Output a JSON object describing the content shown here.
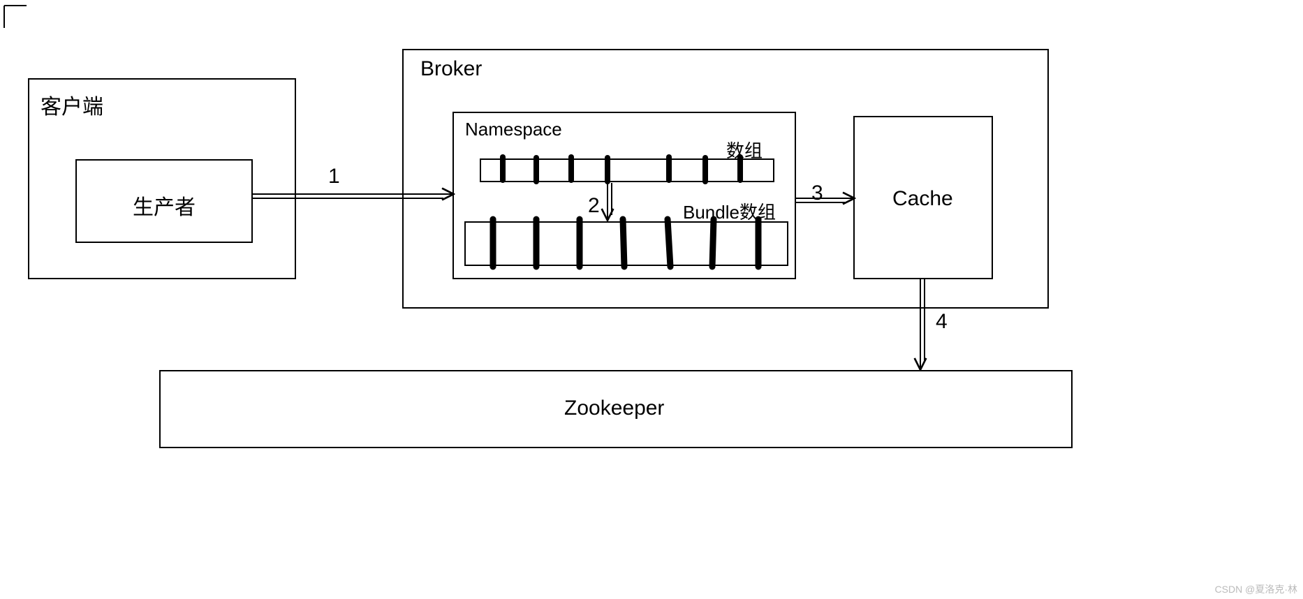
{
  "client": {
    "title": "客户端",
    "producer": "生产者"
  },
  "broker": {
    "title": "Broker",
    "namespace": {
      "title": "Namespace",
      "array_label": "数组",
      "bundle_label": "Bundle数组"
    },
    "cache": "Cache"
  },
  "zookeeper": "Zookeeper",
  "steps": {
    "one": "1",
    "two": "2",
    "three": "3",
    "four": "4"
  },
  "watermark": "CSDN @夏洛克·林"
}
